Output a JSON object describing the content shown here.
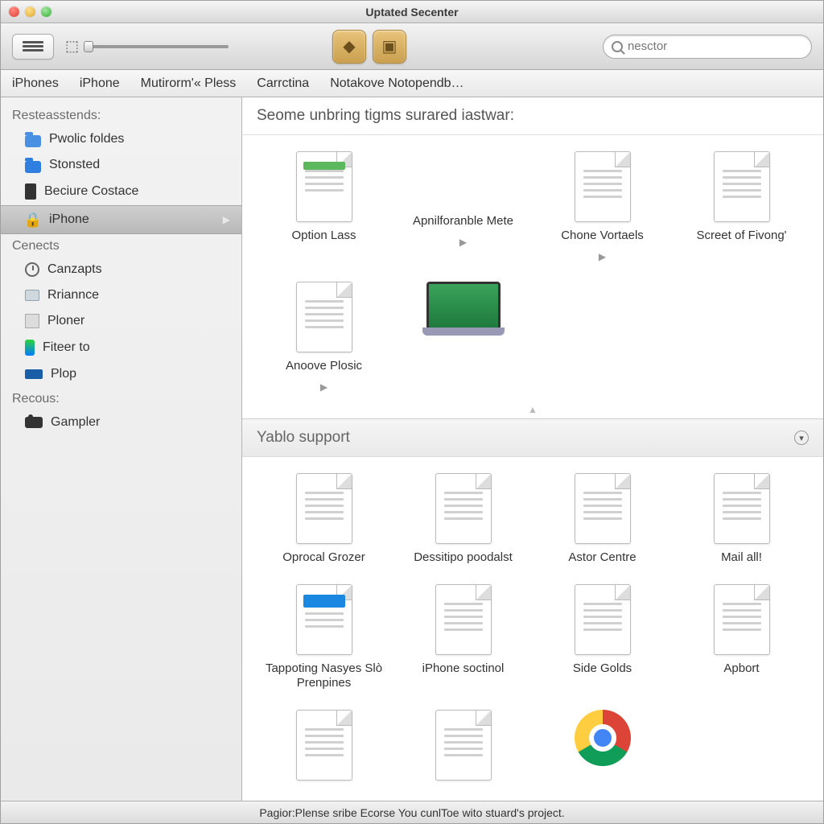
{
  "window": {
    "title": "Uptated Secenter"
  },
  "search": {
    "placeholder": "nesctor"
  },
  "tabs": [
    "iPhones",
    "iPhone",
    "Mutirorm'« Pless",
    "Carrctina",
    "Notakove Notopendb…"
  ],
  "sidebar": {
    "section1": {
      "heading": "Resteasstends:",
      "items": [
        {
          "label": "Pwolic foldes",
          "icon": "folder-blue"
        },
        {
          "label": "Stonsted",
          "icon": "folder-blue2"
        },
        {
          "label": "Beciure Costace",
          "icon": "device-dark"
        },
        {
          "label": "iPhone",
          "icon": "lock",
          "selected": true
        }
      ]
    },
    "section2": {
      "heading": "Cenects",
      "items": [
        {
          "label": "Canzapts",
          "icon": "clock"
        },
        {
          "label": "Rriannce",
          "icon": "printer"
        },
        {
          "label": "Ploner",
          "icon": "fax"
        },
        {
          "label": "Fiteer to",
          "icon": "phone"
        },
        {
          "label": "Plop",
          "icon": "chip"
        }
      ]
    },
    "section3": {
      "heading": "Recous:",
      "items": [
        {
          "label": "Gampler",
          "icon": "camera"
        }
      ]
    }
  },
  "content": {
    "section1": {
      "heading": "Seome unbring tigms surared iastwar:",
      "items": [
        {
          "label": "Option Lass",
          "kind": "doc-rich"
        },
        {
          "label": "Apnilforanble Mete",
          "kind": "cd",
          "arrow": true
        },
        {
          "label": "Chone Vortaels",
          "kind": "doc",
          "arrow": true
        },
        {
          "label": "Screet of Fivong'",
          "kind": "doc"
        },
        {
          "label": "Anoove Plosic",
          "kind": "doc",
          "arrow": true
        },
        {
          "label": "",
          "kind": "laptop"
        }
      ]
    },
    "section2": {
      "heading": "Yablo support",
      "items": [
        {
          "label": "Oprocal Grozer",
          "kind": "doc"
        },
        {
          "label": "Dessitipo poodalst",
          "kind": "doc"
        },
        {
          "label": "Astor Centre",
          "kind": "doc"
        },
        {
          "label": "Mail all!",
          "kind": "doc"
        },
        {
          "label": "Tappoting Nasyes Slò Prenpines",
          "kind": "doc-blue"
        },
        {
          "label": "iPhone soctinol",
          "kind": "doc"
        },
        {
          "label": "Side Golds",
          "kind": "doc"
        },
        {
          "label": "Apbort",
          "kind": "doc"
        },
        {
          "label": "",
          "kind": "doc"
        },
        {
          "label": "",
          "kind": "doc"
        },
        {
          "label": "",
          "kind": "chrome"
        }
      ]
    }
  },
  "status": "Pagior:Plense sribe Ecorse You cunlToe wito stuard's project."
}
